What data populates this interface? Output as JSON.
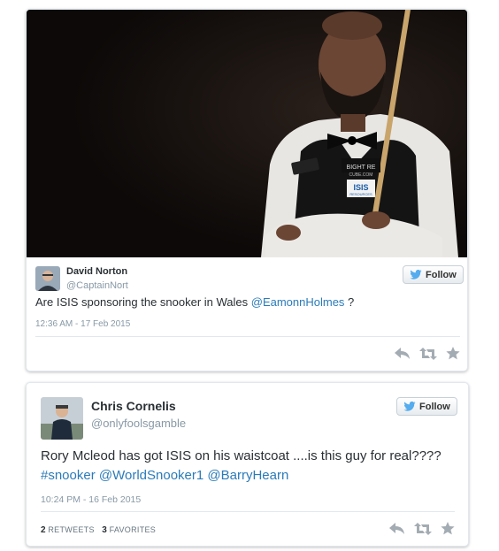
{
  "tweets": [
    {
      "display_name": "David Norton",
      "handle": "@CaptainNort",
      "follow_label": "Follow",
      "text_parts": [
        "Are ISIS sponsoring the snooker in Wales ",
        "@EamonnHolmes",
        " ?"
      ],
      "timestamp": "12:36 AM - 17 Feb 2015",
      "photo": {
        "vest_text_1": "BIGHT RE",
        "vest_text_2": "CUBE.COM",
        "vest_text_3": "ISIS",
        "vest_text_4": "RESOURCES"
      }
    },
    {
      "display_name": "Chris Cornelis",
      "handle": "@onlyfoolsgamble",
      "follow_label": "Follow",
      "text_parts": [
        "Rory Mcleod has got ISIS on his waistcoat ....is this guy for real???? ",
        "#snooker",
        " ",
        "@WorldSnooker1",
        " ",
        "@BarryHearn"
      ],
      "timestamp": "10:24 PM - 16 Feb 2015",
      "retweets_count": "2",
      "retweets_label": "RETWEETS",
      "favorites_count": "3",
      "favorites_label": "FAVORITES"
    }
  ],
  "icons": [
    "twitter-bird-icon",
    "reply-icon",
    "retweet-icon",
    "favorite-star-icon"
  ],
  "colors": {
    "link": "#2b7bb9",
    "muted": "#8899a6",
    "action_icon": "#a4acb3",
    "bird": "#55acee"
  }
}
